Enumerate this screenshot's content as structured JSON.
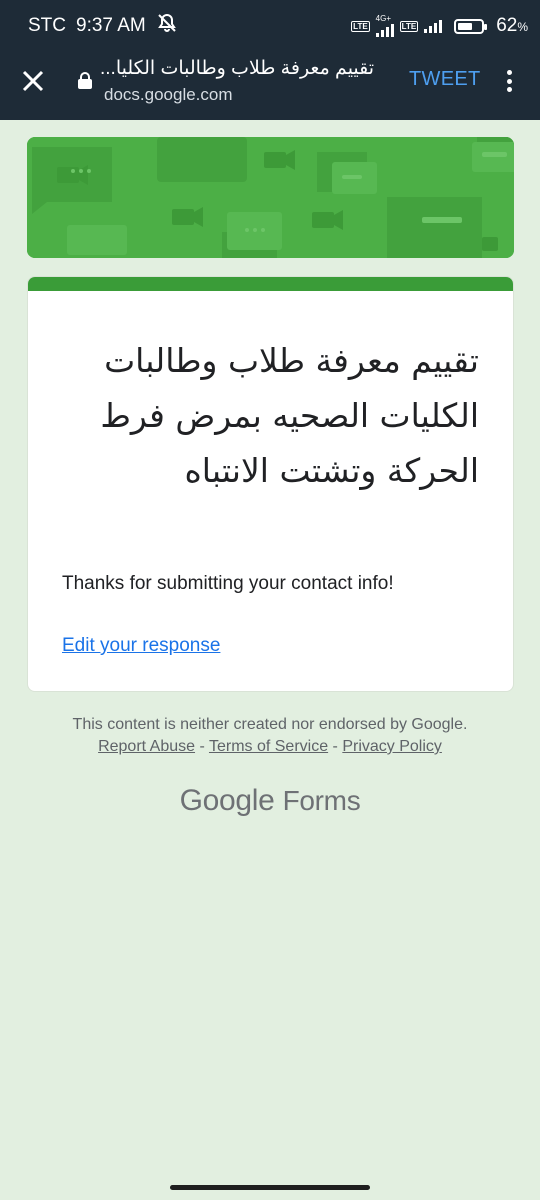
{
  "status_bar": {
    "carrier": "STC",
    "time": "9:37 AM",
    "network_label": "4G+",
    "lte_label": "LTE",
    "battery_percent": "62",
    "battery_symbol": "%",
    "battery_level": 0.62
  },
  "browser": {
    "page_title": "تقييم معرفة طلاب وطالبات الكليا...",
    "url": "docs.google.com",
    "tweet_label": "TWEET"
  },
  "banner": {
    "color": "#4caf46"
  },
  "form": {
    "accent_color": "#3a9c38",
    "title": "تقييم معرفة طلاب وطالبات الكليات الصحيه بمرض فرط الحركة وتشتت الانتباه",
    "confirmation": "Thanks for submitting your contact info!",
    "edit_link": "Edit your response"
  },
  "footer": {
    "disclaimer": "This content is neither created nor endorsed by Google.",
    "report_abuse": "Report Abuse",
    "terms": "Terms of Service",
    "privacy": "Privacy Policy",
    "separator": " - ",
    "brand_google": "Google",
    "brand_forms": "Forms"
  },
  "icons": [
    "muted-icon",
    "signal-icon",
    "battery-icon",
    "close-icon",
    "lock-icon",
    "more-vert-icon"
  ]
}
